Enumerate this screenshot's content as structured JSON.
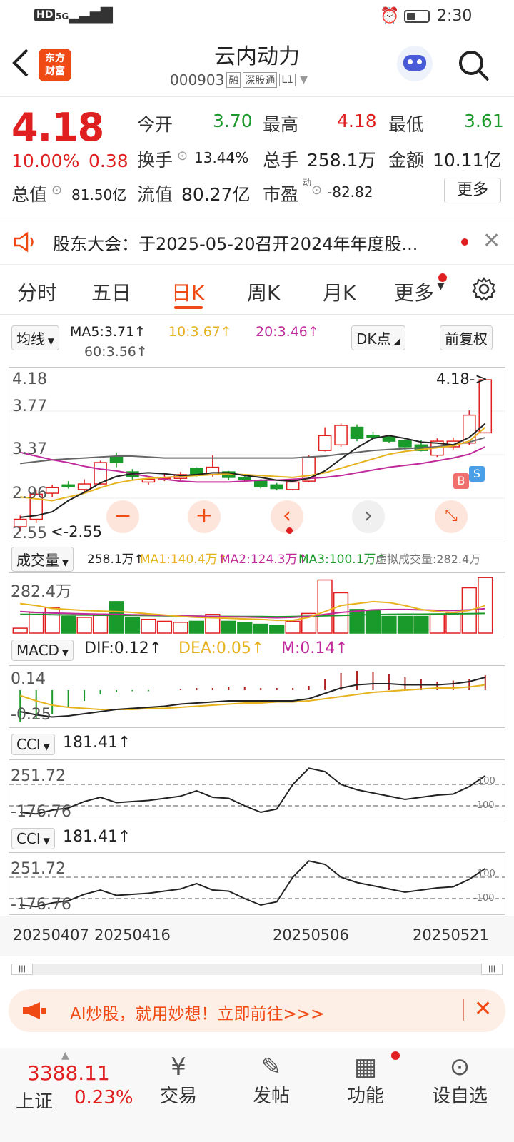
{
  "status": {
    "left_icons": "HD 5G",
    "time": "2:30"
  },
  "header": {
    "back_icon": "chevron-left-icon",
    "logo_line1": "东方",
    "logo_line2": "财富",
    "title": "云内动力",
    "code": "000903",
    "tag_rong": "融",
    "tag_connect": "深股通",
    "tag_level": "L1"
  },
  "quote": {
    "price": "4.18",
    "change_pct": "10.00%",
    "change_abs": "0.38",
    "open_label": "今开",
    "open": "3.70",
    "high_label": "最高",
    "high": "4.18",
    "low_label": "最低",
    "low": "3.61",
    "turnover_label": "换手",
    "turnover": "13.44%",
    "volume_label": "总手",
    "volume": "258.1万",
    "amount_label": "金额",
    "amount": "10.11亿",
    "mktcap_label": "总值",
    "mktcap": "81.50亿",
    "float_label": "流值",
    "float": "80.27亿",
    "pe_label": "市盈",
    "pe_sup": "动",
    "pe": "-82.82",
    "more_label": "更多"
  },
  "notice": {
    "text": "股东大会：于2025-05-20召开2024年年度股..."
  },
  "tabs": [
    "分时",
    "五日",
    "日K",
    "周K",
    "月K",
    "更多"
  ],
  "active_tab": "日K",
  "ma_bar": {
    "selector": "均线",
    "ma5": "MA5:3.71↑",
    "ma10": "10:3.67↑",
    "ma20": "20:3.46↑",
    "ma60": "60:3.56↑",
    "dk": "DK点",
    "adjust": "前复权"
  },
  "price_axis": [
    "4.18",
    "3.77",
    "3.37",
    "2.96",
    "2.55"
  ],
  "price_marks": {
    "max": "4.18->",
    "min": "<-2.55",
    "buy": "B",
    "sell": "S"
  },
  "volume_bar": {
    "selector": "成交量",
    "vol": "258.1万↑",
    "ma1": "MA1:140.4万↑",
    "ma2": "MA2:124.3万↑",
    "ma3": "MA3:100.1万↑",
    "virtual": "虚拟成交量:282.4万",
    "axis_max": "282.4万"
  },
  "macd_bar": {
    "selector": "MACD",
    "dif": "DIF:0.12↑",
    "dea": "DEA:0.05↑",
    "m": "M:0.14↑",
    "axis_top": "0.14",
    "axis_bottom": "-0.25"
  },
  "cci1": {
    "selector": "CCI",
    "value": "181.41↑",
    "axis_top": "251.72",
    "axis_bottom": "-176.76",
    "ref_hi": "100",
    "ref_lo": "-100"
  },
  "cci2": {
    "selector": "CCI",
    "value": "181.41↑",
    "axis_top": "251.72",
    "axis_bottom": "-176.76",
    "ref_hi": "100",
    "ref_lo": "-100"
  },
  "dates": [
    "20250407",
    "20250416",
    "20250506",
    "20250521"
  ],
  "ai_banner": {
    "text": "AI炒股，就用妙想！立即前往>>>"
  },
  "bottom": {
    "index_value": "3388.11",
    "index_name": "上证",
    "index_change": "0.23%",
    "trade": "交易",
    "post": "发帖",
    "func": "功能",
    "watch": "设自选"
  },
  "colors": {
    "up": "#e02020",
    "down": "#1a9a2a",
    "accent": "#f04a14"
  },
  "chart_data": {
    "type": "candlestick",
    "candles": [
      {
        "o": 2.6,
        "c": 2.68,
        "h": 2.72,
        "l": 2.55
      },
      {
        "o": 2.68,
        "c": 2.95,
        "h": 2.99,
        "l": 2.64
      },
      {
        "o": 2.96,
        "c": 3.02,
        "h": 3.05,
        "l": 2.92
      },
      {
        "o": 3.05,
        "c": 3.03,
        "h": 3.09,
        "l": 3.01
      },
      {
        "o": 3.0,
        "c": 3.06,
        "h": 3.11,
        "l": 2.97
      },
      {
        "o": 3.06,
        "c": 3.29,
        "h": 3.31,
        "l": 3.05
      },
      {
        "o": 3.35,
        "c": 3.29,
        "h": 3.4,
        "l": 3.24
      },
      {
        "o": 3.19,
        "c": 3.14,
        "h": 3.22,
        "l": 3.1
      },
      {
        "o": 3.08,
        "c": 3.11,
        "h": 3.14,
        "l": 3.05
      },
      {
        "o": 3.11,
        "c": 3.12,
        "h": 3.17,
        "l": 3.09
      },
      {
        "o": 3.12,
        "c": 3.16,
        "h": 3.19,
        "l": 3.1
      },
      {
        "o": 3.23,
        "c": 3.16,
        "h": 3.24,
        "l": 3.14
      },
      {
        "o": 3.16,
        "c": 3.24,
        "h": 3.37,
        "l": 3.14
      },
      {
        "o": 3.19,
        "c": 3.13,
        "h": 3.2,
        "l": 3.1
      },
      {
        "o": 3.13,
        "c": 3.11,
        "h": 3.16,
        "l": 3.09
      },
      {
        "o": 3.09,
        "c": 3.03,
        "h": 3.11,
        "l": 3.01
      },
      {
        "o": 3.05,
        "c": 3.01,
        "h": 3.07,
        "l": 2.99
      },
      {
        "o": 3.0,
        "c": 3.08,
        "h": 3.1,
        "l": 2.99
      },
      {
        "o": 3.09,
        "c": 3.35,
        "h": 3.37,
        "l": 3.08
      },
      {
        "o": 3.42,
        "c": 3.58,
        "h": 3.67,
        "l": 3.41
      },
      {
        "o": 3.48,
        "c": 3.69,
        "h": 3.71,
        "l": 3.46
      },
      {
        "o": 3.67,
        "c": 3.55,
        "h": 3.7,
        "l": 3.52
      },
      {
        "o": 3.58,
        "c": 3.57,
        "h": 3.62,
        "l": 3.56
      },
      {
        "o": 3.57,
        "c": 3.52,
        "h": 3.59,
        "l": 3.5
      },
      {
        "o": 3.53,
        "c": 3.46,
        "h": 3.55,
        "l": 3.42
      },
      {
        "o": 3.48,
        "c": 3.42,
        "h": 3.53,
        "l": 3.41
      },
      {
        "o": 3.37,
        "c": 3.52,
        "h": 3.55,
        "l": 3.35
      },
      {
        "o": 3.46,
        "c": 3.52,
        "h": 3.56,
        "l": 3.43
      },
      {
        "o": 3.5,
        "c": 3.8,
        "h": 3.85,
        "l": 3.48
      },
      {
        "o": 3.61,
        "c": 4.18,
        "h": 4.18,
        "l": 3.61
      }
    ],
    "ma5": [
      2.7,
      2.72,
      2.76,
      2.88,
      2.97,
      3.07,
      3.14,
      3.17,
      3.18,
      3.17,
      3.15,
      3.16,
      3.18,
      3.18,
      3.15,
      3.13,
      3.1,
      3.09,
      3.12,
      3.2,
      3.33,
      3.45,
      3.55,
      3.58,
      3.55,
      3.51,
      3.5,
      3.48,
      3.56,
      3.71
    ],
    "ma10": [
      2.92,
      2.9,
      2.88,
      2.92,
      2.96,
      3.02,
      3.07,
      3.1,
      3.12,
      3.13,
      3.14,
      3.15,
      3.16,
      3.17,
      3.16,
      3.15,
      3.14,
      3.13,
      3.15,
      3.18,
      3.23,
      3.28,
      3.33,
      3.38,
      3.41,
      3.43,
      3.45,
      3.47,
      3.52,
      3.67
    ],
    "ma20": [
      3.4,
      3.36,
      3.32,
      3.29,
      3.25,
      3.22,
      3.2,
      3.17,
      3.14,
      3.11,
      3.09,
      3.08,
      3.08,
      3.08,
      3.09,
      3.1,
      3.1,
      3.11,
      3.12,
      3.13,
      3.15,
      3.18,
      3.21,
      3.24,
      3.26,
      3.28,
      3.31,
      3.34,
      3.38,
      3.46
    ],
    "ma60": [
      3.28,
      3.3,
      3.32,
      3.33,
      3.34,
      3.35,
      3.36,
      3.36,
      3.35,
      3.34,
      3.34,
      3.34,
      3.34,
      3.34,
      3.34,
      3.34,
      3.34,
      3.34,
      3.35,
      3.36,
      3.38,
      3.4,
      3.42,
      3.43,
      3.44,
      3.45,
      3.46,
      3.48,
      3.51,
      3.56
    ],
    "volume": [
      25,
      105,
      130,
      85,
      80,
      90,
      160,
      80,
      70,
      60,
      55,
      60,
      95,
      60,
      55,
      45,
      40,
      60,
      100,
      270,
      205,
      120,
      115,
      85,
      85,
      85,
      95,
      100,
      230,
      282
    ],
    "vol_ma1": [
      150,
      140,
      125,
      120,
      115,
      112,
      110,
      105,
      98,
      92,
      85,
      80,
      78,
      75,
      72,
      70,
      65,
      65,
      80,
      110,
      140,
      150,
      160,
      155,
      140,
      120,
      110,
      105,
      115,
      140
    ],
    "vol_ma2": [
      110,
      105,
      102,
      100,
      98,
      96,
      95,
      93,
      92,
      90,
      88,
      86,
      85,
      83,
      82,
      80,
      78,
      80,
      85,
      95,
      105,
      112,
      118,
      120,
      120,
      118,
      116,
      115,
      118,
      124
    ],
    "vol_ma3": [
      95,
      95,
      93,
      92,
      92,
      91,
      90,
      90,
      89,
      88,
      87,
      86,
      85,
      85,
      84,
      84,
      83,
      84,
      86,
      88,
      90,
      92,
      94,
      95,
      96,
      96,
      97,
      98,
      99,
      100
    ],
    "dif": [
      -0.2,
      -0.23,
      -0.25,
      -0.24,
      -0.22,
      -0.2,
      -0.18,
      -0.17,
      -0.16,
      -0.15,
      -0.13,
      -0.12,
      -0.11,
      -0.1,
      -0.1,
      -0.1,
      -0.1,
      -0.1,
      -0.08,
      -0.03,
      0.02,
      0.05,
      0.06,
      0.06,
      0.05,
      0.05,
      0.05,
      0.06,
      0.08,
      0.12
    ],
    "dea": [
      -0.05,
      -0.1,
      -0.14,
      -0.16,
      -0.17,
      -0.18,
      -0.18,
      -0.18,
      -0.17,
      -0.17,
      -0.16,
      -0.15,
      -0.14,
      -0.13,
      -0.12,
      -0.12,
      -0.11,
      -0.11,
      -0.1,
      -0.08,
      -0.06,
      -0.04,
      -0.02,
      -0.01,
      0.0,
      0.01,
      0.02,
      0.02,
      0.03,
      0.05
    ],
    "macd": [
      -0.3,
      -0.26,
      -0.22,
      -0.16,
      -0.1,
      -0.04,
      -0.02,
      -0.01,
      -0.01,
      0.0,
      0.01,
      0.02,
      0.02,
      0.03,
      0.03,
      0.02,
      0.02,
      0.02,
      0.04,
      0.1,
      0.16,
      0.18,
      0.17,
      0.15,
      0.12,
      0.1,
      0.08,
      0.09,
      0.1,
      0.14
    ],
    "cci": [
      -160,
      -176,
      -140,
      -120,
      -60,
      -20,
      -70,
      -60,
      -50,
      -30,
      -10,
      40,
      -20,
      -30,
      -100,
      -160,
      -130,
      100,
      251,
      220,
      100,
      50,
      20,
      -10,
      -40,
      -20,
      0,
      10,
      80,
      181
    ]
  }
}
